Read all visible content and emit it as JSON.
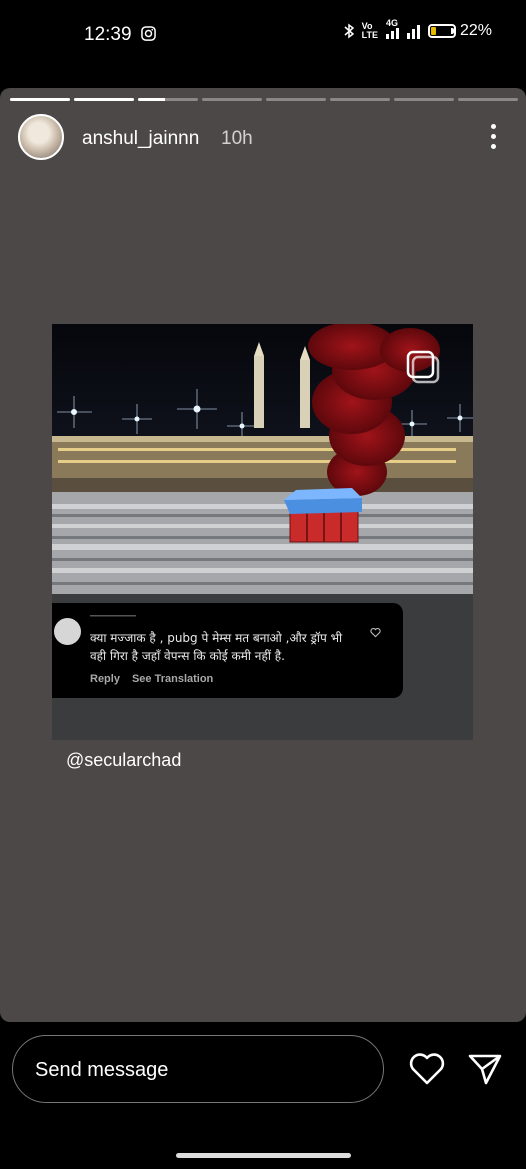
{
  "status_bar": {
    "time": "12:39",
    "volte": "Vo\nLTE",
    "network": "4G",
    "battery": "22%",
    "battery_level": 0.22,
    "icons": [
      "instagram-icon",
      "bluetooth-icon",
      "volte-icon",
      "signal-icon",
      "battery-icon"
    ]
  },
  "story": {
    "progress_segments": 8,
    "active_segment": 3,
    "active_progress": 0.45,
    "username": "anshul_jainnn",
    "time_ago": "10h",
    "post": {
      "comment_text": "क्या मज्जाक है , pubg पे मेम्स मत बनाओ ,और ड्रॉप भी वही गिरा है जहाँ वेपन्स कि कोई कमी नहीं है.",
      "reply_label": "Reply",
      "see_translation_label": "See Translation"
    },
    "mention": "@secularchad"
  },
  "bottom_bar": {
    "message_placeholder": "Send message",
    "icons": [
      "heart-icon",
      "send-icon"
    ]
  },
  "colors": {
    "story_background": "#4d4848",
    "battery_fill": "#e6b800",
    "smoke": "#8b0d12",
    "crate": "#c92a2a"
  }
}
